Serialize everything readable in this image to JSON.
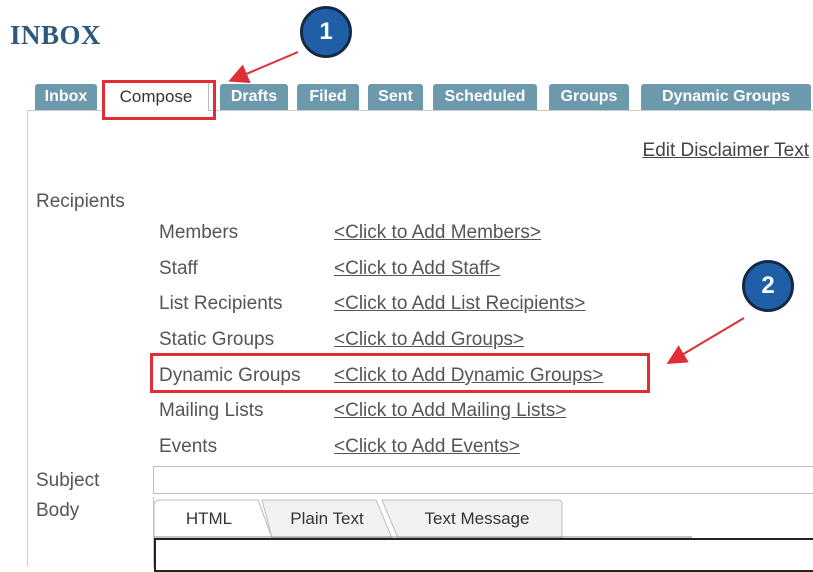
{
  "page": {
    "title": "INBOX"
  },
  "tabs": [
    {
      "label": "Inbox",
      "active": false
    },
    {
      "label": "Compose",
      "active": true
    },
    {
      "label": "Drafts",
      "active": false
    },
    {
      "label": "Filed",
      "active": false
    },
    {
      "label": "Sent",
      "active": false
    },
    {
      "label": "Scheduled",
      "active": false
    },
    {
      "label": "Groups",
      "active": false
    },
    {
      "label": "Dynamic Groups",
      "active": false
    }
  ],
  "compose": {
    "edit_disclaimer": "Edit Disclaimer Text",
    "recipients_label": "Recipients",
    "recipients": [
      {
        "label": "Members",
        "link": "<Click to Add Members>"
      },
      {
        "label": "Staff",
        "link": "<Click to Add Staff>"
      },
      {
        "label": "List Recipients",
        "link": "<Click to Add List Recipients>"
      },
      {
        "label": "Static Groups",
        "link": "<Click to Add Groups>"
      },
      {
        "label": "Dynamic Groups",
        "link": "<Click to Add Dynamic Groups>"
      },
      {
        "label": "Mailing Lists",
        "link": "<Click to Add Mailing Lists>"
      },
      {
        "label": "Events",
        "link": "<Click to Add Events>"
      }
    ],
    "subject_label": "Subject",
    "subject_value": "",
    "body_label": "Body",
    "editor_tabs": [
      {
        "label": "HTML",
        "active": true
      },
      {
        "label": "Plain Text",
        "active": false
      },
      {
        "label": "Text Message",
        "active": false
      }
    ]
  },
  "annotations": {
    "step1": "1",
    "step2": "2",
    "highlight_color": "#e02e36",
    "badge_color": "#1f5fa8"
  },
  "colors": {
    "tab_bg": "#6d99ad",
    "title": "#2d5a7c"
  }
}
